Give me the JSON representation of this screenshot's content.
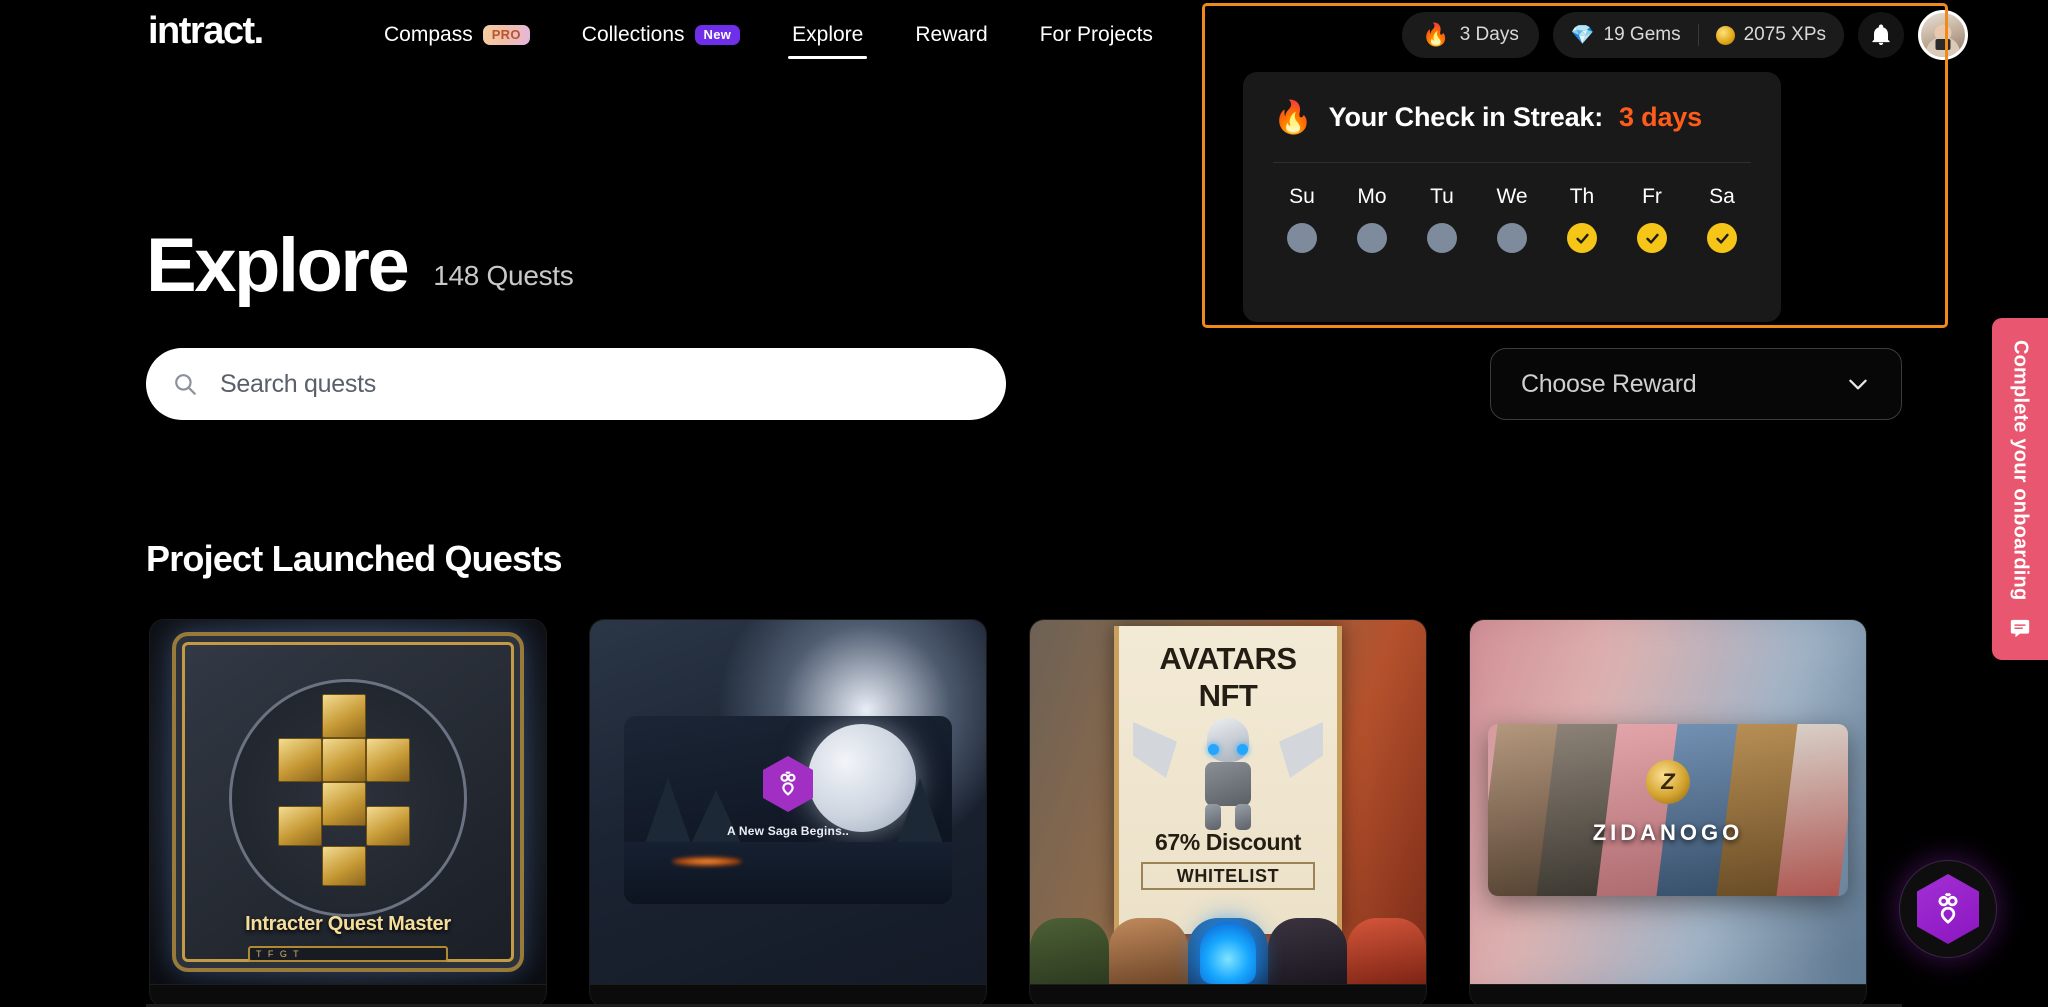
{
  "brand": {
    "logo_text": "intract."
  },
  "nav": {
    "items": [
      {
        "label": "Compass",
        "badge": "PRO",
        "active": false
      },
      {
        "label": "Collections",
        "badge": "New",
        "active": false
      },
      {
        "label": "Explore",
        "badge": "",
        "active": true
      },
      {
        "label": "Reward",
        "badge": "",
        "active": false
      },
      {
        "label": "For Projects",
        "badge": "",
        "active": false
      }
    ]
  },
  "header_right": {
    "streak_pill": {
      "icon": "fire-icon",
      "label": "3 Days"
    },
    "gems": {
      "icon": "gem-icon",
      "label": "19 Gems"
    },
    "xps": {
      "icon": "coin-icon",
      "label": "2075 XPs"
    },
    "notification_icon": "bell-icon",
    "avatar_name": "user-avatar"
  },
  "streak_panel": {
    "fire_icon": "fire-icon",
    "title": "Your Check in Streak:",
    "count": "3 days",
    "days": [
      {
        "label": "Su",
        "checked": false
      },
      {
        "label": "Mo",
        "checked": false
      },
      {
        "label": "Tu",
        "checked": false
      },
      {
        "label": "We",
        "checked": false
      },
      {
        "label": "Th",
        "checked": true
      },
      {
        "label": "Fr",
        "checked": true
      },
      {
        "label": "Sa",
        "checked": true
      }
    ],
    "highlight_color": "#f08a1b",
    "checked_color": "#f5c518",
    "unchecked_color": "#7d8b9c",
    "accent_color": "#ff5c1a"
  },
  "page": {
    "title": "Explore",
    "quest_count": "148 Quests"
  },
  "search": {
    "icon": "search-icon",
    "placeholder": "Search quests",
    "value": ""
  },
  "reward_select": {
    "label": "Choose Reward",
    "icon": "chevron-down-icon"
  },
  "section": {
    "title": "Project Launched Quests"
  },
  "cards": [
    {
      "name": "intracter-quest-master",
      "caption": "Intracter Quest Master",
      "sub": "T F G T"
    },
    {
      "name": "a-new-saga-begins",
      "caption": "A New Saga Begins..",
      "sub": ""
    },
    {
      "name": "avatars-nft",
      "title_line1": "AVATARS",
      "title_line2": "NFT",
      "discount": "67% Discount",
      "whitelist": "WHITELIST"
    },
    {
      "name": "zidanogo",
      "brand": "ZIDANOGO",
      "coin": "Z"
    }
  ],
  "side_tab": {
    "label": "Complete your onboarding",
    "icon": "feedback-icon",
    "color": "#e8566f"
  },
  "fab": {
    "icon": "intract-hex-icon",
    "color": "#a32fd6"
  }
}
